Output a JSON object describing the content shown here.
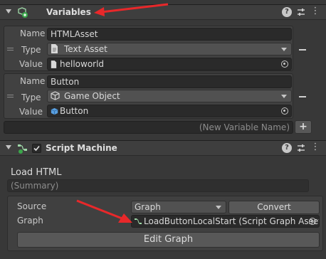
{
  "variables_component": {
    "title": "Variables",
    "icon": "variables-icon",
    "help_icon": "help-icon",
    "settings_icon": "preset-sliders-icon",
    "more_icon": "more-vertical-icon",
    "entries": [
      {
        "name_label": "Name",
        "name": "HTMLAsset",
        "type_label": "Type",
        "type": "Text Asset",
        "type_icon": "text-asset-icon",
        "value_label": "Value",
        "value": "helloworld",
        "value_icon": "text-asset-icon"
      },
      {
        "name_label": "Name",
        "name": "Button",
        "type_label": "Type",
        "type": "Game Object",
        "type_icon": "game-object-cube-icon",
        "value_label": "Value",
        "value": "Button",
        "value_icon": "game-object-cube-icon"
      }
    ],
    "new_variable_placeholder": "(New Variable Name)",
    "add_label": "+"
  },
  "script_machine": {
    "title": "Script Machine",
    "enabled": true,
    "icon": "script-machine-icon",
    "graph_title": "Load HTML",
    "summary_placeholder": "(Summary)",
    "source_label": "Source",
    "source_value": "Graph",
    "convert_label": "Convert",
    "graph_label": "Graph",
    "graph_value": "LoadButtonLocalStart (Script Graph Asset)",
    "graph_icon": "script-graph-asset-icon",
    "edit_graph_label": "Edit Graph"
  },
  "colors": {
    "background": "#383838",
    "annotation_arrow": "#e8282a",
    "field_bg": "#2a2a2a"
  }
}
